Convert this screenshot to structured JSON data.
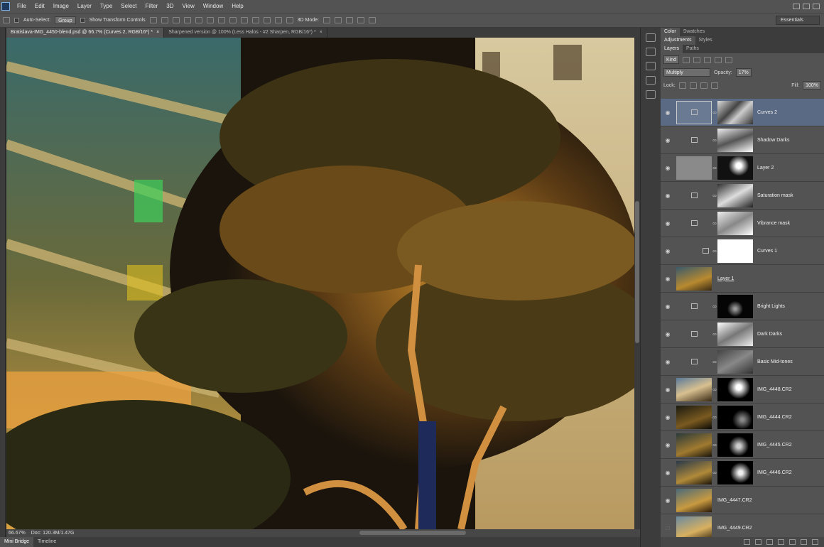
{
  "menubar": {
    "items": [
      "File",
      "Edit",
      "Image",
      "Layer",
      "Type",
      "Select",
      "Filter",
      "3D",
      "View",
      "Window",
      "Help"
    ]
  },
  "options": {
    "auto_select_label": "Auto-Select:",
    "auto_select_value": "Group",
    "transform_label": "Show Transform Controls",
    "mode_3d_label": "3D Mode:",
    "workspace": "Essentials"
  },
  "tabs": [
    {
      "label": "Bratislava-IMG_4450-blend.psd @ 66.7% (Curves 2, RGB/16*) *"
    },
    {
      "label": "Sharpened version @ 100% (Less Halos - #2 Sharpen, RGB/16*) *"
    }
  ],
  "status": {
    "zoom": "66.67%",
    "doc": "Doc: 120.3M/1.47G"
  },
  "bottom_tabs": [
    "Mini Bridge",
    "Timeline"
  ],
  "panel": {
    "tabs_row1": [
      "Color",
      "Swatches"
    ],
    "tabs_row2": [
      "Adjustments",
      "Styles"
    ],
    "tabs_row3": [
      "Layers",
      "Paths"
    ],
    "kind_label": "Kind",
    "blend_mode": "Multiply",
    "opacity_label": "Opacity:",
    "opacity_value": "17%",
    "lock_label": "Lock:",
    "fill_label": "Fill:",
    "fill_value": "100%"
  },
  "layers": [
    {
      "name": "Curves 2",
      "selected": true
    },
    {
      "name": "Shadow Darks"
    },
    {
      "name": "Layer 2"
    },
    {
      "name": "Saturation mask"
    },
    {
      "name": "Vibrance mask"
    },
    {
      "name": "Curves 1"
    },
    {
      "name": "Layer 1"
    },
    {
      "name": "Bright Lights"
    },
    {
      "name": "Dark Darks"
    },
    {
      "name": "Basic Mid-tones"
    },
    {
      "name": "IMG_4448.CR2"
    },
    {
      "name": "IMG_4444.CR2"
    },
    {
      "name": "IMG_4445.CR2"
    },
    {
      "name": "IMG_4446.CR2"
    },
    {
      "name": "IMG_4447.CR2"
    },
    {
      "name": "IMG_4449.CR2"
    }
  ]
}
